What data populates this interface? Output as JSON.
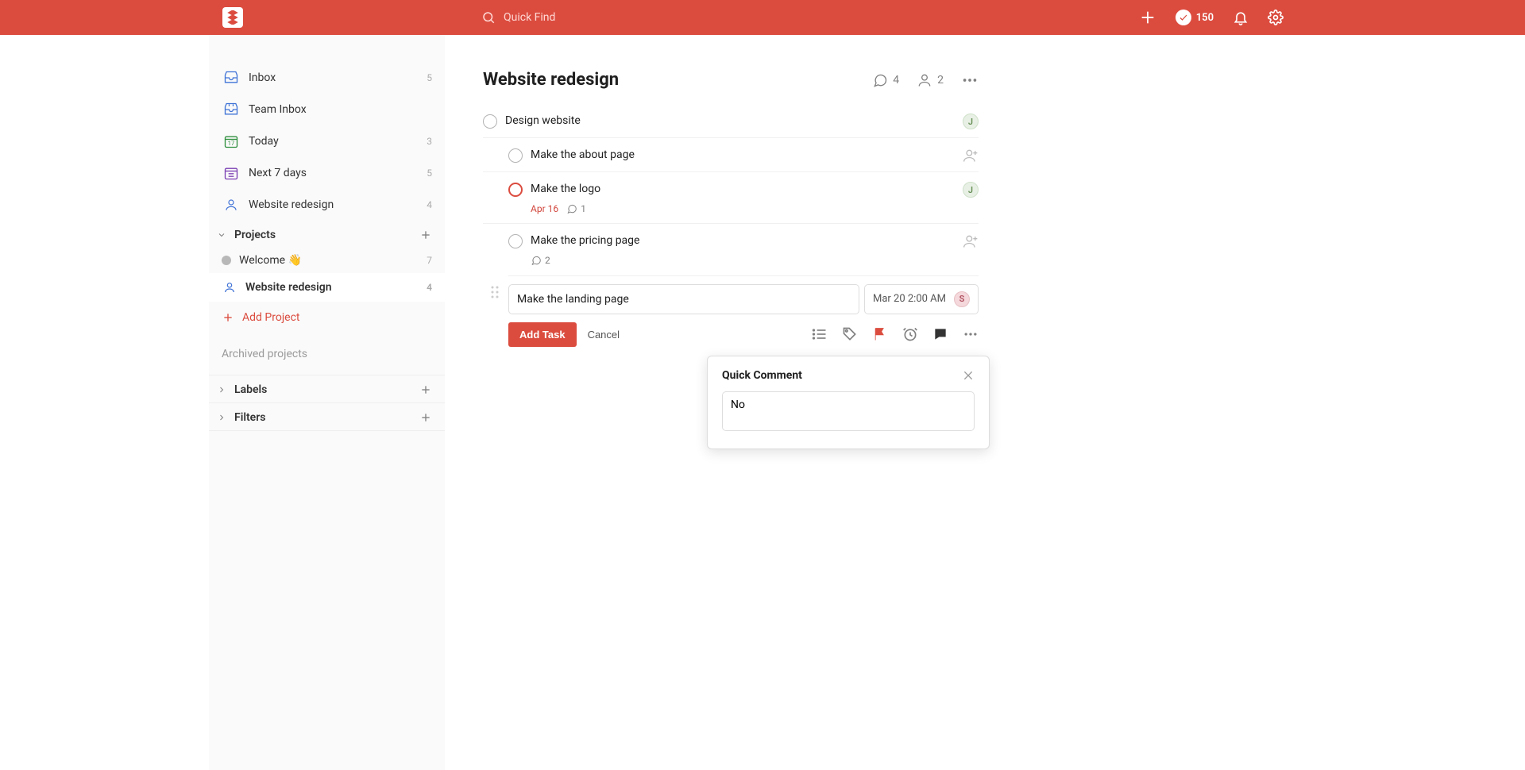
{
  "topbar": {
    "search_placeholder": "Quick Find",
    "karma": "150"
  },
  "sidebar": {
    "inbox": {
      "label": "Inbox",
      "count": "5"
    },
    "team_inbox": {
      "label": "Team Inbox"
    },
    "today": {
      "label": "Today",
      "count": "3"
    },
    "next7": {
      "label": "Next 7 days",
      "count": "5"
    },
    "shared_project": {
      "label": "Website redesign",
      "count": "4"
    },
    "projects_header": "Projects",
    "projects": [
      {
        "label": "Welcome 👋",
        "count": "7",
        "color": "#b8b8b8"
      },
      {
        "label": "Website redesign",
        "count": "4",
        "color": "#4073d6"
      }
    ],
    "add_project": "Add Project",
    "archived": "Archived projects",
    "labels_header": "Labels",
    "filters_header": "Filters"
  },
  "project": {
    "title": "Website redesign",
    "comments_count": "4",
    "people_count": "2"
  },
  "tasks": [
    {
      "title": "Design website",
      "assignee": "J",
      "subtasks": [
        {
          "title": "Make the about page"
        },
        {
          "title": "Make the logo",
          "priority": true,
          "date": "Apr 16",
          "comments": "1",
          "assignee": "J"
        },
        {
          "title": "Make the pricing page",
          "comments": "2"
        }
      ]
    }
  ],
  "editor": {
    "text": "Make the landing page",
    "schedule": "Mar 20 2:00 AM",
    "assignee_initial": "S",
    "add_task": "Add Task",
    "cancel": "Cancel"
  },
  "quick_comment": {
    "title": "Quick Comment",
    "value": "No"
  }
}
